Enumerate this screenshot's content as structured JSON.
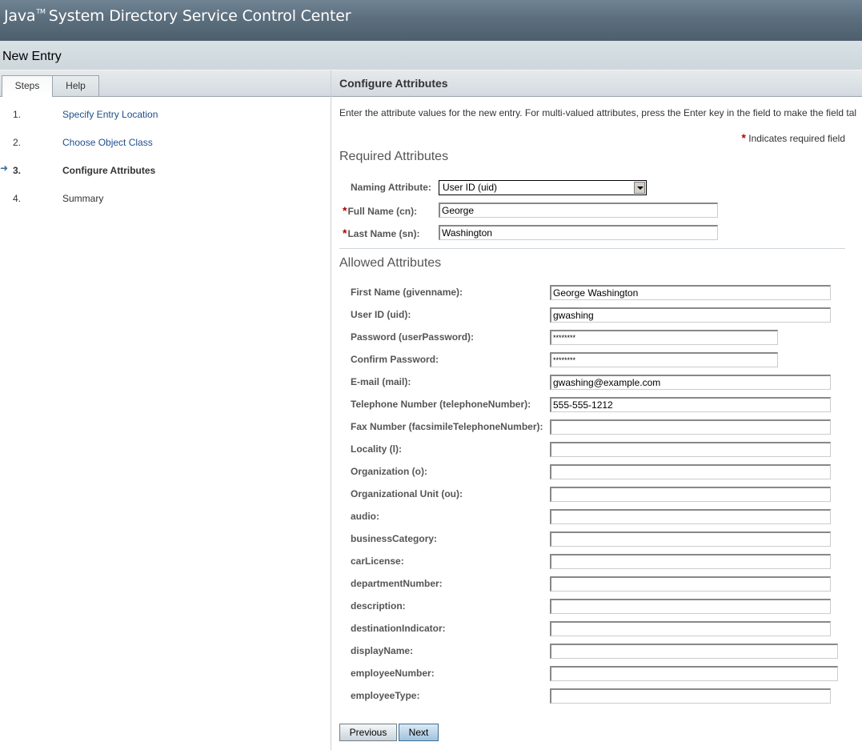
{
  "app": {
    "title": "Java",
    "trademark": "TM",
    "title_rest": "System Directory Service Control Center"
  },
  "page": {
    "title": "New Entry"
  },
  "left": {
    "tabs": [
      {
        "label": "Steps",
        "active": true
      },
      {
        "label": "Help",
        "active": false
      }
    ],
    "current_marker_icon": "arrow-right-icon",
    "steps": [
      {
        "num": "1.",
        "label": "Specify Entry Location",
        "link": true
      },
      {
        "num": "2.",
        "label": "Choose Object Class",
        "link": true
      },
      {
        "num": "3.",
        "label": "Configure Attributes",
        "current": true
      },
      {
        "num": "4.",
        "label": "Summary",
        "link": false
      }
    ]
  },
  "main": {
    "section_title": "Configure Attributes",
    "instructions": "Enter the attribute values for the new entry. For multi-valued attributes, press the Enter key in the field to make the field tal",
    "required_note_star": "*",
    "required_note": "Indicates required field",
    "required_title": "Required Attributes",
    "naming_attribute": {
      "label": "Naming Attribute:",
      "selected": "User ID (uid)"
    },
    "required_fields": [
      {
        "label": "Full Name (cn):",
        "value": "George",
        "required": true
      },
      {
        "label": "Last Name (sn):",
        "value": "Washington",
        "required": true
      }
    ],
    "allowed_title": "Allowed Attributes",
    "allowed_fields": [
      {
        "label": "First Name (givenname):",
        "value": "George Washington"
      },
      {
        "label": "User ID (uid):",
        "value": "gwashing"
      },
      {
        "label": "Password (userPassword):",
        "value": "********",
        "type": "password"
      },
      {
        "label": "Confirm Password:",
        "value": "********",
        "type": "password"
      },
      {
        "label": "E-mail (mail):",
        "value": "gwashing@example.com"
      },
      {
        "label": "Telephone Number (telephoneNumber):",
        "value": "555-555-1212"
      },
      {
        "label": "Fax Number (facsimileTelephoneNumber):",
        "value": ""
      },
      {
        "label": "Locality (l):",
        "value": ""
      },
      {
        "label": "Organization (o):",
        "value": ""
      },
      {
        "label": "Organizational Unit (ou):",
        "value": ""
      },
      {
        "label": "audio:",
        "value": ""
      },
      {
        "label": "businessCategory:",
        "value": ""
      },
      {
        "label": "carLicense:",
        "value": ""
      },
      {
        "label": "departmentNumber:",
        "value": ""
      },
      {
        "label": "description:",
        "value": ""
      },
      {
        "label": "destinationIndicator:",
        "value": ""
      },
      {
        "label": "displayName:",
        "value": ""
      },
      {
        "label": "employeeNumber:",
        "value": ""
      },
      {
        "label": "employeeType:",
        "value": ""
      }
    ],
    "buttons": {
      "previous": "Previous",
      "next": "Next"
    }
  }
}
